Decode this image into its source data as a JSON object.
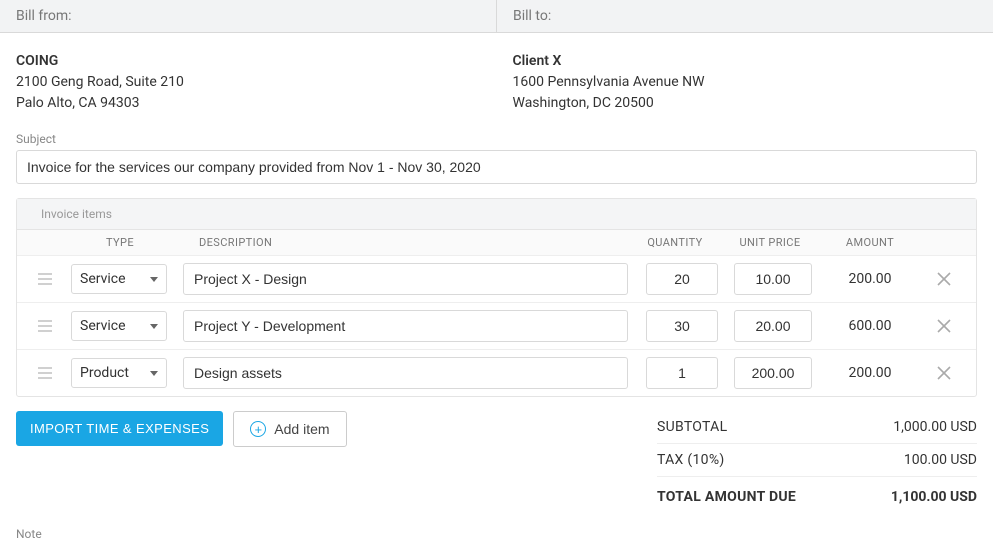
{
  "header": {
    "bill_from_label": "Bill from:",
    "bill_to_label": "Bill to:"
  },
  "bill_from": {
    "name": "COING",
    "line1": "2100 Geng Road, Suite 210",
    "line2": "Palo Alto, CA 94303"
  },
  "bill_to": {
    "name": "Client X",
    "line1": "1600 Pennsylvania Avenue NW",
    "line2": "Washington, DC 20500"
  },
  "subject": {
    "label": "Subject",
    "value": "Invoice for the services our company provided from Nov 1 - Nov 30, 2020"
  },
  "items_section": {
    "title": "Invoice items",
    "columns": {
      "type": "TYPE",
      "description": "DESCRIPTION",
      "quantity": "QUANTITY",
      "unit_price": "UNIT PRICE",
      "amount": "AMOUNT"
    }
  },
  "items": [
    {
      "type": "Service",
      "description": "Project X - Design",
      "quantity": "20",
      "unit_price": "10.00",
      "amount": "200.00"
    },
    {
      "type": "Service",
      "description": "Project Y - Development",
      "quantity": "30",
      "unit_price": "20.00",
      "amount": "600.00"
    },
    {
      "type": "Product",
      "description": "Design assets",
      "quantity": "1",
      "unit_price": "200.00",
      "amount": "200.00"
    }
  ],
  "buttons": {
    "import": "IMPORT TIME & EXPENSES",
    "add_item": "Add item"
  },
  "totals": {
    "subtotal_label": "SUBTOTAL",
    "subtotal_value": "1,000.00 USD",
    "tax_label": "TAX  (10%)",
    "tax_value": "100.00 USD",
    "grand_label": "TOTAL AMOUNT DUE",
    "grand_value": "1,100.00 USD"
  },
  "note_label": "Note"
}
